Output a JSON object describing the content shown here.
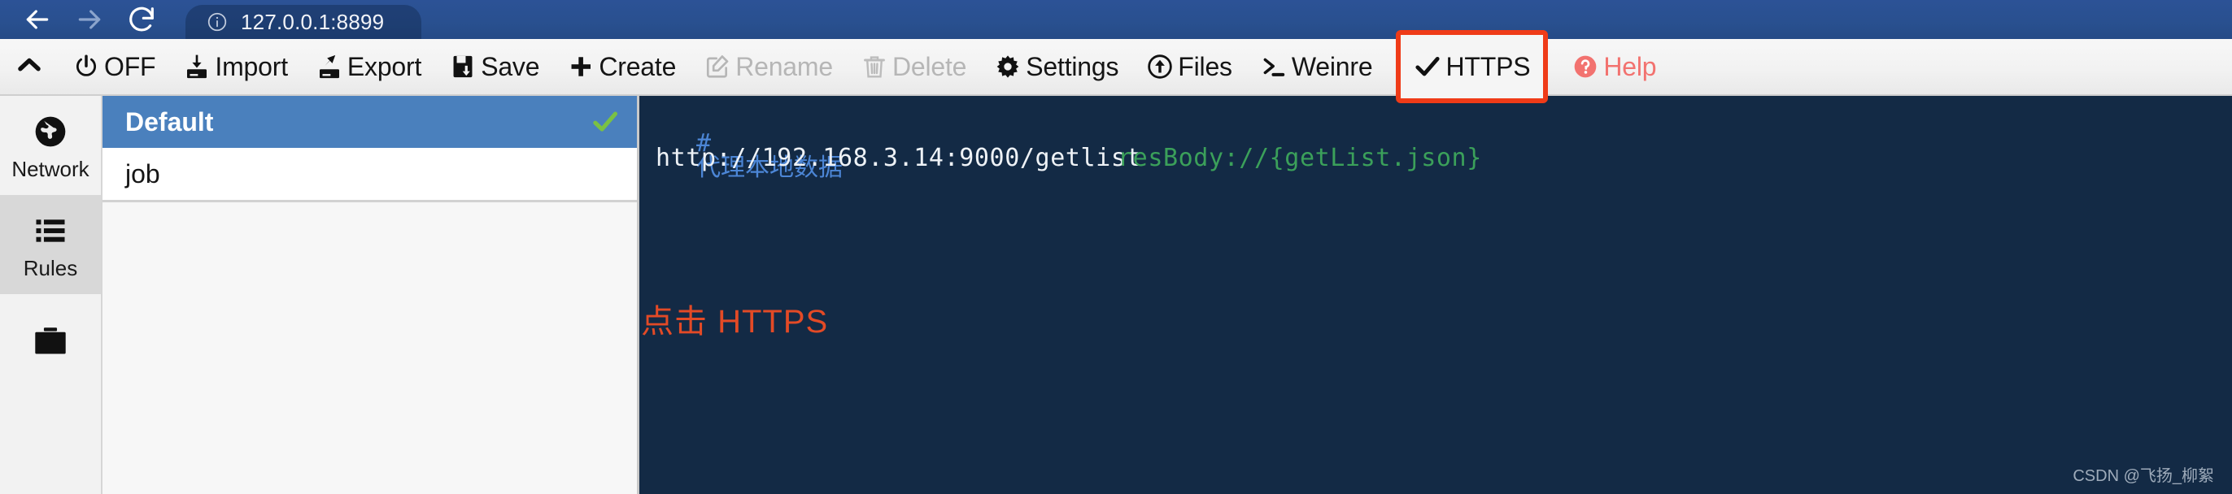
{
  "browser": {
    "back_icon": "arrow-left-icon",
    "forward_icon": "arrow-right-icon",
    "reload_icon": "reload-icon",
    "info_icon": "info-circle-icon",
    "url": "127.0.0.1:8899"
  },
  "toolbar": {
    "collapse_icon": "chevron-up-icon",
    "buttons": [
      {
        "id": "off",
        "label": "OFF",
        "icon": "power-icon",
        "disabled": false,
        "highlighted": false
      },
      {
        "id": "import",
        "label": "Import",
        "icon": "import-icon",
        "disabled": false,
        "highlighted": false
      },
      {
        "id": "export",
        "label": "Export",
        "icon": "export-icon",
        "disabled": false,
        "highlighted": false
      },
      {
        "id": "save",
        "label": "Save",
        "icon": "save-icon",
        "disabled": false,
        "highlighted": false
      },
      {
        "id": "create",
        "label": "Create",
        "icon": "plus-icon",
        "disabled": false,
        "highlighted": false
      },
      {
        "id": "rename",
        "label": "Rename",
        "icon": "edit-square-icon",
        "disabled": true,
        "highlighted": false
      },
      {
        "id": "delete",
        "label": "Delete",
        "icon": "trash-icon",
        "disabled": true,
        "highlighted": false
      },
      {
        "id": "settings",
        "label": "Settings",
        "icon": "gear-icon",
        "disabled": false,
        "highlighted": false
      },
      {
        "id": "files",
        "label": "Files",
        "icon": "upload-circle-icon",
        "disabled": false,
        "highlighted": false
      },
      {
        "id": "weinre",
        "label": "Weinre",
        "icon": "terminal-icon",
        "disabled": false,
        "highlighted": false
      },
      {
        "id": "https",
        "label": "HTTPS",
        "icon": "check-icon",
        "disabled": false,
        "highlighted": true
      },
      {
        "id": "help",
        "label": "Help",
        "icon": "help-circle-icon",
        "disabled": false,
        "highlighted": false
      }
    ],
    "highlight_color": "#ef3b18",
    "help_color": "#f2726f"
  },
  "sidebar": {
    "items": [
      {
        "id": "network",
        "label": "Network",
        "icon": "globe-icon",
        "active": false
      },
      {
        "id": "rules",
        "label": "Rules",
        "icon": "list-icon",
        "active": true
      },
      {
        "id": "values",
        "label": "",
        "icon": "folder-icon",
        "active": false
      }
    ]
  },
  "rules_list": {
    "items": [
      {
        "name": "Default",
        "selected": true,
        "checked": true
      },
      {
        "name": "job",
        "selected": false,
        "checked": false
      }
    ],
    "selected_bg": "#4a80bd",
    "check_color": "#7ac143"
  },
  "editor": {
    "background": "#132a45",
    "comment_hash": "#",
    "comment_text": "代理本地数据",
    "comment_color": "#4c86d6",
    "rule_pattern": "http://192.168.3.14:9000/getlist",
    "rule_pattern_color": "#eef2f6",
    "rule_target": "resBody://{getList.json}",
    "rule_target_color": "#3ba05a"
  },
  "annotation": {
    "text": "点击 HTTPS",
    "color": "#e34a26"
  },
  "watermark": {
    "text": "CSDN @飞扬_柳絮"
  }
}
